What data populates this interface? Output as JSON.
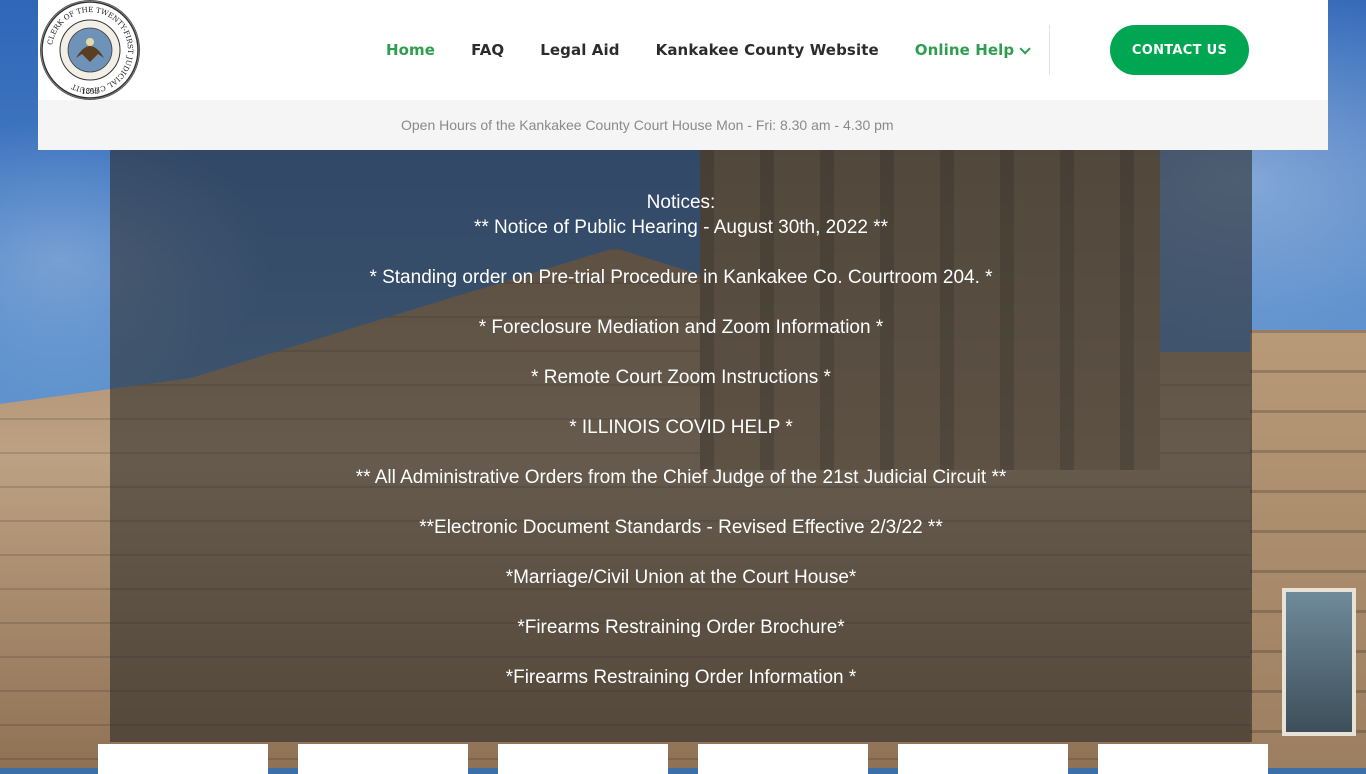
{
  "logo": {
    "ring_text": "CLERK OF THE TWENTY-FIRST JUDICIAL CIRCUIT",
    "year": "1853"
  },
  "nav": {
    "items": [
      {
        "label": "Home",
        "state": "active"
      },
      {
        "label": "FAQ"
      },
      {
        "label": "Legal Aid"
      },
      {
        "label": "Kankakee County Website"
      },
      {
        "label": "Online Help",
        "has_dropdown": true
      }
    ],
    "contact_label": "CONTACT US"
  },
  "info_bar": {
    "text": "Open Hours of the Kankakee County Court House Mon - Fri: 8.30 am - 4.30 pm"
  },
  "notices": {
    "title": "Notices:",
    "items": [
      "** Notice of Public Hearing - August 30th, 2022 **",
      "* Standing order on Pre-trial Procedure in Kankakee Co. Courtroom 204. *",
      "* Foreclosure Mediation and Zoom Information *",
      "* Remote Court Zoom Instructions *",
      "* ILLINOIS COVID HELP *",
      "** All Administrative Orders from the Chief Judge of the 21st Judicial Circuit **",
      "**Electronic Document Standards - Revised Effective 2/3/22 **",
      "*Marriage/Civil Union at the Court House*",
      "*Firearms Restraining Order Brochure*",
      "*Firearms Restraining Order Information *"
    ]
  },
  "colors": {
    "accent": "#00a651",
    "nav_active": "#2e9e4e",
    "nav_text": "#2c2c2c",
    "info_text": "#8a8a8a"
  }
}
